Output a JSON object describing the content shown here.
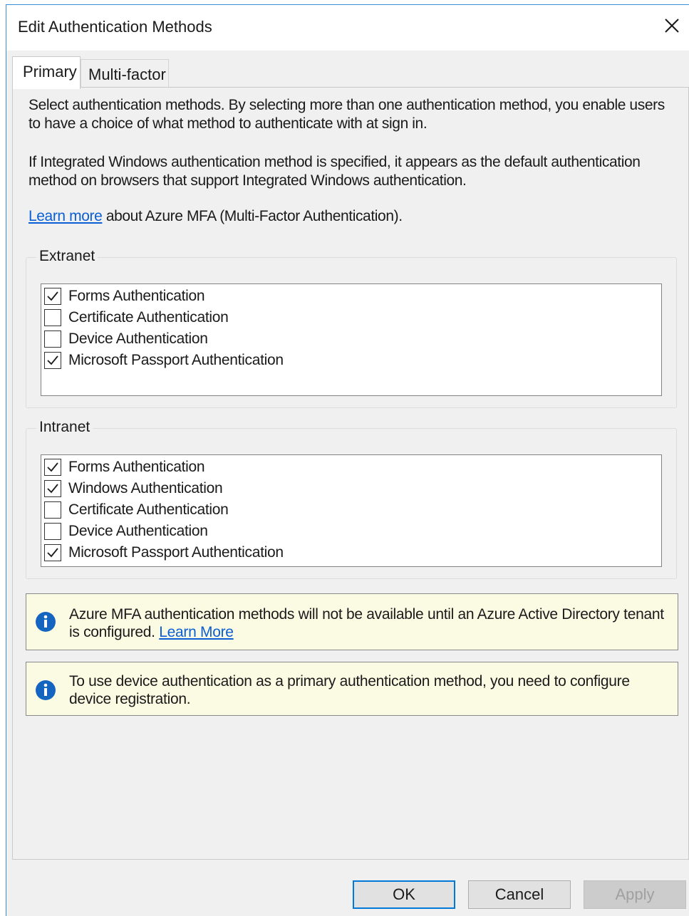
{
  "window": {
    "title": "Edit Authentication Methods"
  },
  "tabs": [
    {
      "label": "Primary",
      "selected": true
    },
    {
      "label": "Multi-factor",
      "selected": false
    }
  ],
  "description": {
    "p1": "Select authentication methods. By selecting more than one authentication method, you enable users to have a choice of what method to authenticate with at sign in.",
    "p2": "If Integrated Windows authentication method is specified, it appears as the default authentication method on browsers that support Integrated Windows authentication.",
    "p3_link": "Learn more",
    "p3_text": " about Azure MFA (Multi-Factor Authentication)."
  },
  "extranet": {
    "label": "Extranet",
    "items": [
      {
        "label": "Forms Authentication",
        "checked": true
      },
      {
        "label": "Certificate Authentication",
        "checked": false
      },
      {
        "label": "Device Authentication",
        "checked": false
      },
      {
        "label": "Microsoft Passport Authentication",
        "checked": true
      }
    ]
  },
  "intranet": {
    "label": "Intranet",
    "items": [
      {
        "label": "Forms Authentication",
        "checked": true
      },
      {
        "label": "Windows Authentication",
        "checked": true
      },
      {
        "label": "Certificate Authentication",
        "checked": false
      },
      {
        "label": "Device Authentication",
        "checked": false
      },
      {
        "label": "Microsoft Passport Authentication",
        "checked": true
      }
    ]
  },
  "info_messages": [
    {
      "text": "Azure MFA authentication methods will not be available until an Azure Active Directory tenant is configured. ",
      "link": "Learn More"
    },
    {
      "text": "To use device authentication as a primary authentication method, you need to configure device registration.",
      "link": ""
    }
  ],
  "buttons": {
    "ok": "OK",
    "cancel": "Cancel",
    "apply": "Apply",
    "apply_enabled": false
  },
  "colors": {
    "link": "#0b5fd6",
    "info_icon": "#1565c0",
    "info_background": "#fbfbe3",
    "focus_border": "#0078d7"
  },
  "icons": [
    "close-icon",
    "checkmark-icon",
    "info-icon"
  ]
}
